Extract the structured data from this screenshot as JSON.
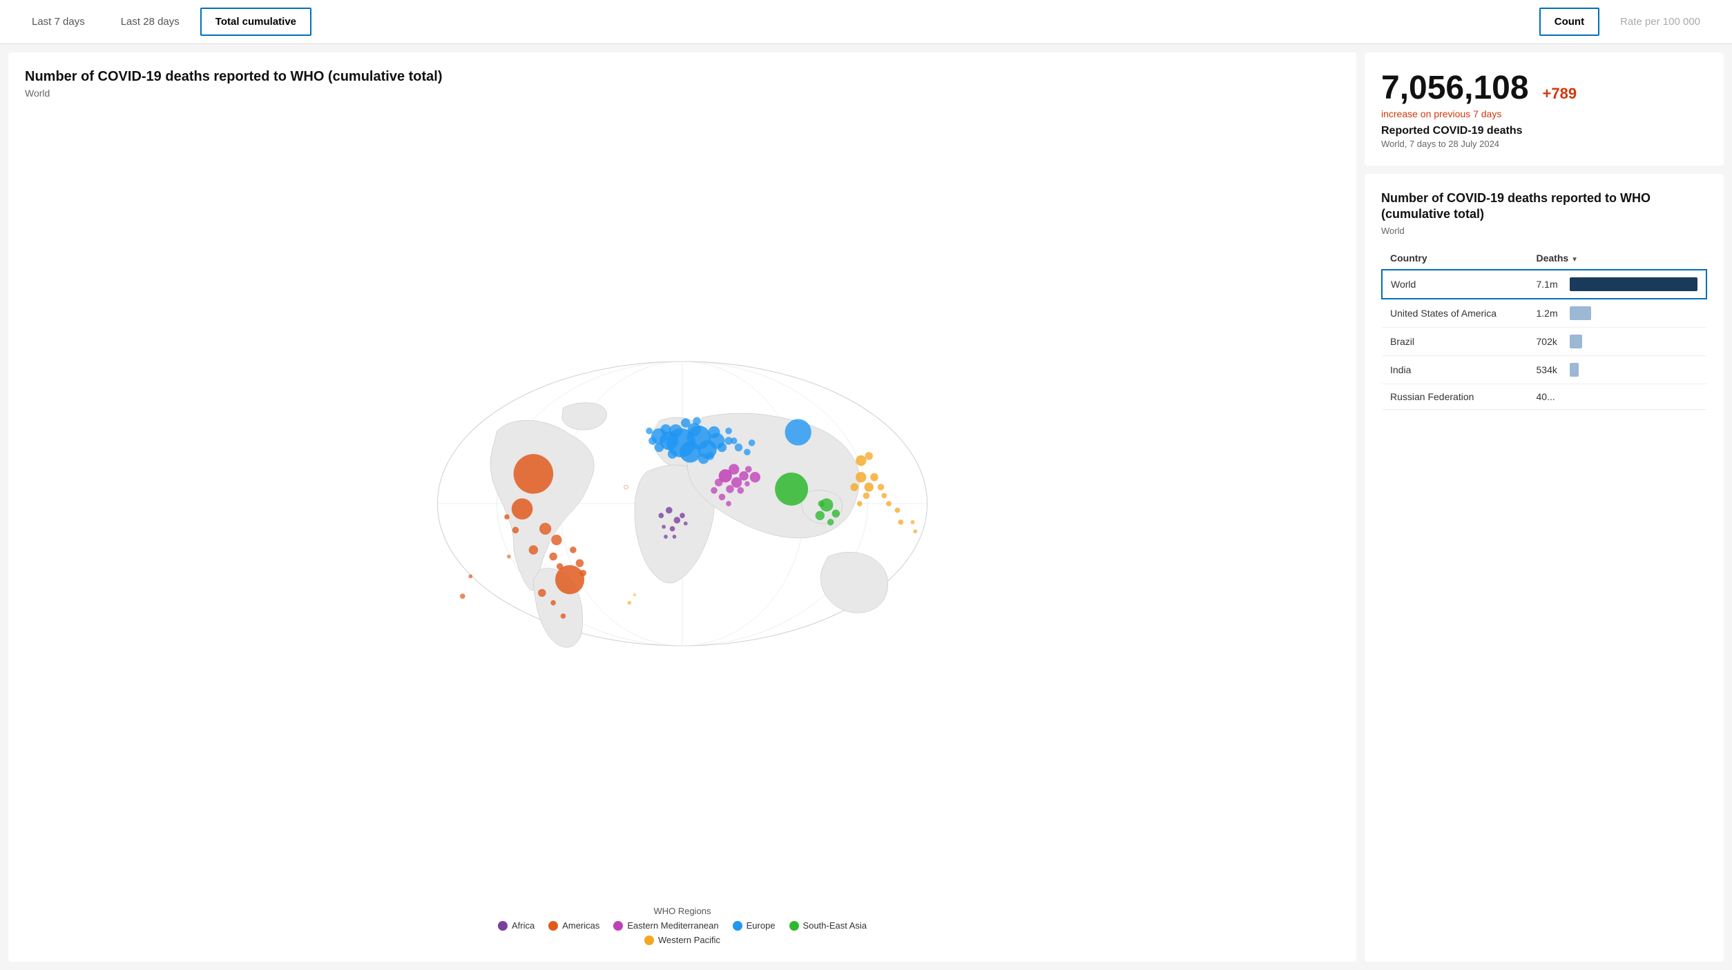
{
  "topbar": {
    "tabs": [
      {
        "id": "last7",
        "label": "Last 7 days",
        "active": false
      },
      {
        "id": "last28",
        "label": "Last 28 days",
        "active": false
      },
      {
        "id": "total",
        "label": "Total cumulative",
        "active": true
      }
    ],
    "metrics": [
      {
        "id": "count",
        "label": "Count",
        "active": true
      },
      {
        "id": "rate",
        "label": "Rate per 100 000",
        "active": false
      }
    ]
  },
  "map": {
    "title": "Number of COVID-19 deaths reported to WHO (cumulative total)",
    "subtitle": "World",
    "legend_title": "WHO Regions",
    "legend_items": [
      {
        "label": "Africa",
        "color": "#7b3f9e"
      },
      {
        "label": "Americas",
        "color": "#e05a1e"
      },
      {
        "label": "Eastern Mediterranean",
        "color": "#c040b8"
      },
      {
        "label": "Europe",
        "color": "#2196f3"
      },
      {
        "label": "South-East Asia",
        "color": "#2eb82e"
      },
      {
        "label": "Western Pacific",
        "color": "#f5a623"
      }
    ]
  },
  "stats": {
    "total": "7,056,108",
    "increase": "+789",
    "increase_label": "increase on previous 7 days",
    "deaths_label": "Reported COVID-19 deaths",
    "meta": "World, 7 days to 28 July 2024"
  },
  "table": {
    "title": "Number of COVID-19 deaths reported to WHO (cumulative total)",
    "subtitle": "World",
    "col_country": "Country",
    "col_deaths": "Deaths",
    "rows": [
      {
        "country": "World",
        "deaths": "7.1m",
        "bar_pct": 100,
        "bar_type": "dark",
        "selected": true
      },
      {
        "country": "United States of America",
        "deaths": "1.2m",
        "bar_pct": 17,
        "bar_type": "light",
        "selected": false
      },
      {
        "country": "Brazil",
        "deaths": "702k",
        "bar_pct": 10,
        "bar_type": "light",
        "selected": false
      },
      {
        "country": "India",
        "deaths": "534k",
        "bar_pct": 7,
        "bar_type": "light",
        "selected": false
      },
      {
        "country": "Russian Federation",
        "deaths": "40...",
        "bar_pct": 0,
        "bar_type": "light",
        "selected": false
      }
    ]
  }
}
